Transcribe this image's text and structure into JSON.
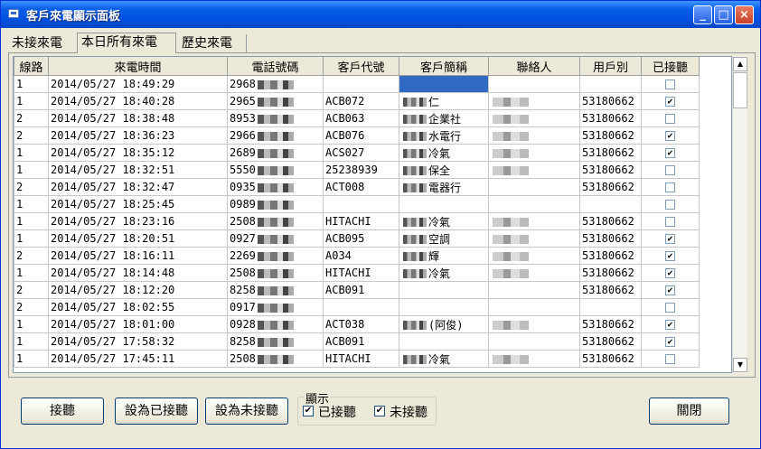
{
  "window": {
    "title": "客戶來電顯示面板",
    "minimize": "_",
    "maximize": "□",
    "close": "×"
  },
  "tabs": [
    {
      "label": "未接來電"
    },
    {
      "label": "本日所有來電"
    },
    {
      "label": "歷史來電"
    }
  ],
  "table": {
    "columns": [
      "線路",
      "來電時間",
      "電話號碼",
      "客戶代號",
      "客戶簡稱",
      "聯絡人",
      "用戶別",
      "已接聽"
    ],
    "rows": [
      {
        "line": "1",
        "time": "2014/05/27  18:49:29",
        "phone": "2968",
        "code": "",
        "name": "",
        "contact": "",
        "user": "",
        "answered": false
      },
      {
        "line": "1",
        "time": "2014/05/27  18:40:28",
        "phone": "2965",
        "code": "ACB072",
        "name": "仁",
        "contact": "",
        "user": "53180662",
        "answered": true
      },
      {
        "line": "2",
        "time": "2014/05/27  18:38:48",
        "phone": "8953",
        "code": "ACB063",
        "name": "企業社",
        "contact": "",
        "user": "53180662",
        "answered": false
      },
      {
        "line": "2",
        "time": "2014/05/27  18:36:23",
        "phone": "2966",
        "code": "ACB076",
        "name": "水電行",
        "contact": "",
        "user": "53180662",
        "answered": true
      },
      {
        "line": "1",
        "time": "2014/05/27  18:35:12",
        "phone": "2689",
        "code": "ACS027",
        "name": "冷氣",
        "contact": "",
        "user": "53180662",
        "answered": true
      },
      {
        "line": "1",
        "time": "2014/05/27  18:32:51",
        "phone": "5550",
        "code": "25238939",
        "name": "保全",
        "contact": "",
        "user": "53180662",
        "answered": false
      },
      {
        "line": "2",
        "time": "2014/05/27  18:32:47",
        "phone": "0935",
        "code": "ACT008",
        "name": "電器行",
        "contact": "",
        "user": "53180662",
        "answered": false
      },
      {
        "line": "1",
        "time": "2014/05/27  18:25:45",
        "phone": "0989",
        "code": "",
        "name": "",
        "contact": "",
        "user": "",
        "answered": false
      },
      {
        "line": "1",
        "time": "2014/05/27  18:23:16",
        "phone": "2508",
        "code": "HITACHI",
        "name": "冷氣",
        "contact": "",
        "user": "53180662",
        "answered": false
      },
      {
        "line": "1",
        "time": "2014/05/27  18:20:51",
        "phone": "0927",
        "code": "ACB095",
        "name": "空調",
        "contact": "",
        "user": "53180662",
        "answered": true
      },
      {
        "line": "2",
        "time": "2014/05/27  18:16:11",
        "phone": "2269",
        "code": "A034",
        "name": "輝",
        "contact": "",
        "user": "53180662",
        "answered": true
      },
      {
        "line": "1",
        "time": "2014/05/27  18:14:48",
        "phone": "2508",
        "code": "HITACHI",
        "name": "冷氣",
        "contact": "",
        "user": "53180662",
        "answered": true
      },
      {
        "line": "2",
        "time": "2014/05/27  18:12:20",
        "phone": "8258",
        "code": "ACB091",
        "name": "",
        "contact": "",
        "user": "53180662",
        "answered": true
      },
      {
        "line": "2",
        "time": "2014/05/27  18:02:55",
        "phone": "0917",
        "code": "",
        "name": "",
        "contact": "",
        "user": "",
        "answered": false
      },
      {
        "line": "1",
        "time": "2014/05/27  18:01:00",
        "phone": "0928",
        "code": "ACT038",
        "name": "(阿俊)",
        "contact": "",
        "user": "53180662",
        "answered": true
      },
      {
        "line": "1",
        "time": "2014/05/27  17:58:32",
        "phone": "8258",
        "code": "ACB091",
        "name": "",
        "contact": "",
        "user": "53180662",
        "answered": true
      },
      {
        "line": "1",
        "time": "2014/05/27  17:45:11",
        "phone": "2508",
        "code": "HITACHI",
        "name": "冷氣",
        "contact": "",
        "user": "53180662",
        "answered": false
      }
    ]
  },
  "buttons": {
    "answer": "接聽",
    "set_answered": "設為已接聽",
    "set_unanswered": "設為未接聽",
    "close": "關閉"
  },
  "display_group": {
    "title": "顯示",
    "answered_label": "已接聽",
    "unanswered_label": "未接聽",
    "answered_checked": true,
    "unanswered_checked": true
  },
  "colors": {
    "selection": "#316ac5",
    "titlebar": "#0054e3"
  }
}
